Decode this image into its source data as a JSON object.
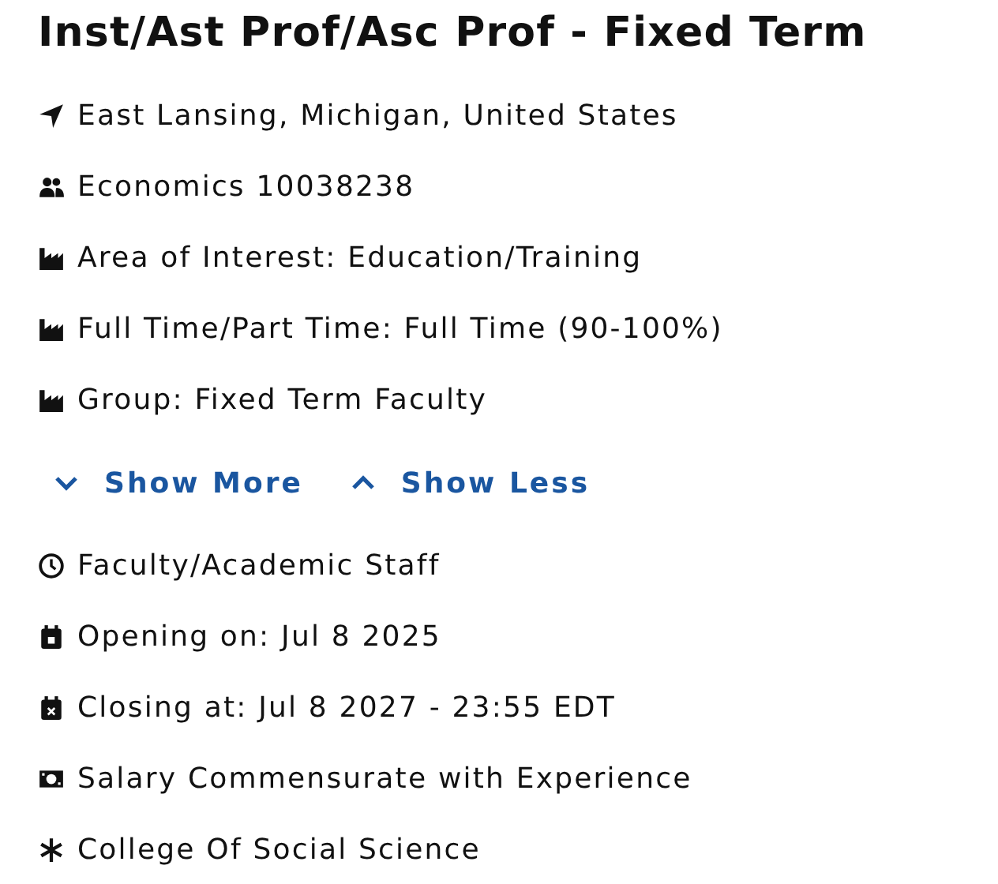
{
  "title": "Inst/Ast Prof/Asc Prof - Fixed Term",
  "details": [
    {
      "kind": "location",
      "text": "East Lansing, Michigan, United States"
    },
    {
      "kind": "department",
      "text": "Economics 10038238"
    },
    {
      "kind": "category",
      "text": "Area of Interest: Education/Training"
    },
    {
      "kind": "category",
      "text": "Full Time/Part Time: Full Time (90-100%)"
    },
    {
      "kind": "category",
      "text": "Group: Fixed Term Faculty"
    }
  ],
  "toggles": [
    {
      "kind": "more",
      "label": "Show More"
    },
    {
      "kind": "less",
      "label": "Show Less"
    }
  ],
  "more_details": [
    {
      "kind": "clock",
      "text": "Faculty/Academic Staff"
    },
    {
      "kind": "opening",
      "text": "Opening on: Jul 8 2025"
    },
    {
      "kind": "closing",
      "text": "Closing at: Jul 8 2027 - 23:55 EDT"
    },
    {
      "kind": "salary",
      "text": "Salary Commensurate with Experience"
    },
    {
      "kind": "college",
      "text": "College Of Social Science"
    }
  ]
}
